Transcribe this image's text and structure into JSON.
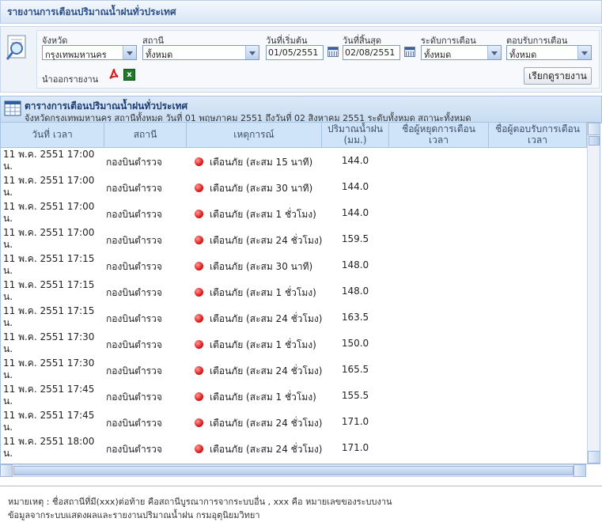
{
  "header": {
    "title": "รายงานการเตือนปริมาณน้ำฝนทั่วประเทศ"
  },
  "filters": {
    "province_label": "จังหวัด",
    "province_value": "กรุงเทพมหานคร",
    "station_label": "สถานี",
    "station_value": "ทั้งหมด",
    "start_label": "วันที่เริ่มต้น",
    "start_value": "01/05/2551",
    "end_label": "วันที่สิ้นสุด",
    "end_value": "02/08/2551",
    "level_label": "ระดับการเตือน",
    "level_value": "ทั้งหมด",
    "response_label": "ตอบรับการเตือน",
    "response_value": "ทั้งหมด",
    "export_label": "นำออกรายงาน",
    "submit_label": "เรียกดูรายงาน"
  },
  "table": {
    "title": "ตารางการเตือนปริมาณน้ำฝนทั่วประเทศ",
    "subtitle": "จังหวัดกรุงเทพมหานคร สถานีทั้งหมด วันที่ 01 พฤษภาคม 2551 ถึงวันที่ 02 สิงหาคม 2551 ระดับทั้งหมด สถานะทั้งหมด",
    "columns": [
      "วันที่ เวลา",
      "สถานี",
      "เหตุการณ์",
      "ปริมาณน้ำฝน (มม.)",
      "ชื่อผู้หยุดการเตือน เวลา",
      "ชื่อผู้ตอบรับการเตือน เวลา"
    ],
    "rows": [
      {
        "datetime": "11 พ.ค. 2551 17:00 น.",
        "station": "กองบินตำรวจ",
        "event": "เตือนภัย (สะสม 15 นาที)",
        "rain": "144.0"
      },
      {
        "datetime": "11 พ.ค. 2551 17:00 น.",
        "station": "กองบินตำรวจ",
        "event": "เตือนภัย (สะสม 30 นาที)",
        "rain": "144.0"
      },
      {
        "datetime": "11 พ.ค. 2551 17:00 น.",
        "station": "กองบินตำรวจ",
        "event": "เตือนภัย (สะสม 1 ชั่วโมง)",
        "rain": "144.0"
      },
      {
        "datetime": "11 พ.ค. 2551 17:00 น.",
        "station": "กองบินตำรวจ",
        "event": "เตือนภัย (สะสม 24 ชั่วโมง)",
        "rain": "159.5"
      },
      {
        "datetime": "11 พ.ค. 2551 17:15 น.",
        "station": "กองบินตำรวจ",
        "event": "เตือนภัย (สะสม 30 นาที)",
        "rain": "148.0"
      },
      {
        "datetime": "11 พ.ค. 2551 17:15 น.",
        "station": "กองบินตำรวจ",
        "event": "เตือนภัย (สะสม 1 ชั่วโมง)",
        "rain": "148.0"
      },
      {
        "datetime": "11 พ.ค. 2551 17:15 น.",
        "station": "กองบินตำรวจ",
        "event": "เตือนภัย (สะสม 24 ชั่วโมง)",
        "rain": "163.5"
      },
      {
        "datetime": "11 พ.ค. 2551 17:30 น.",
        "station": "กองบินตำรวจ",
        "event": "เตือนภัย (สะสม 1 ชั่วโมง)",
        "rain": "150.0"
      },
      {
        "datetime": "11 พ.ค. 2551 17:30 น.",
        "station": "กองบินตำรวจ",
        "event": "เตือนภัย (สะสม 24 ชั่วโมง)",
        "rain": "165.5"
      },
      {
        "datetime": "11 พ.ค. 2551 17:45 น.",
        "station": "กองบินตำรวจ",
        "event": "เตือนภัย (สะสม 1 ชั่วโมง)",
        "rain": "155.5"
      },
      {
        "datetime": "11 พ.ค. 2551 17:45 น.",
        "station": "กองบินตำรวจ",
        "event": "เตือนภัย (สะสม 24 ชั่วโมง)",
        "rain": "171.0"
      },
      {
        "datetime": "11 พ.ค. 2551 18:00 น.",
        "station": "กองบินตำรวจ",
        "event": "เตือนภัย (สะสม 24 ชั่วโมง)",
        "rain": "171.0"
      }
    ]
  },
  "notes": {
    "line1": "หมายเหตุ : ชื่อสถานีที่มี(xxx)ต่อท้าย คือสถานีบูรณาการจากระบบอื่น , xxx คือ หมายเลขของระบบงาน",
    "line2": "ข้อมูลจากระบบแสดงผลและรายงานปริมาณน้ำฝน กรมอุตุนิยมวิทยา"
  },
  "icons": {
    "search": "search-magnifier-icon",
    "pdf": "pdf-icon",
    "excel": "excel-icon",
    "calendar": "calendar-icon",
    "table": "table-icon",
    "alert": "red-alert-dot-icon"
  },
  "colors": {
    "header_text": "#2b4f8a",
    "alert": "#e01a1a",
    "column_bg": "#cfe3f9"
  }
}
